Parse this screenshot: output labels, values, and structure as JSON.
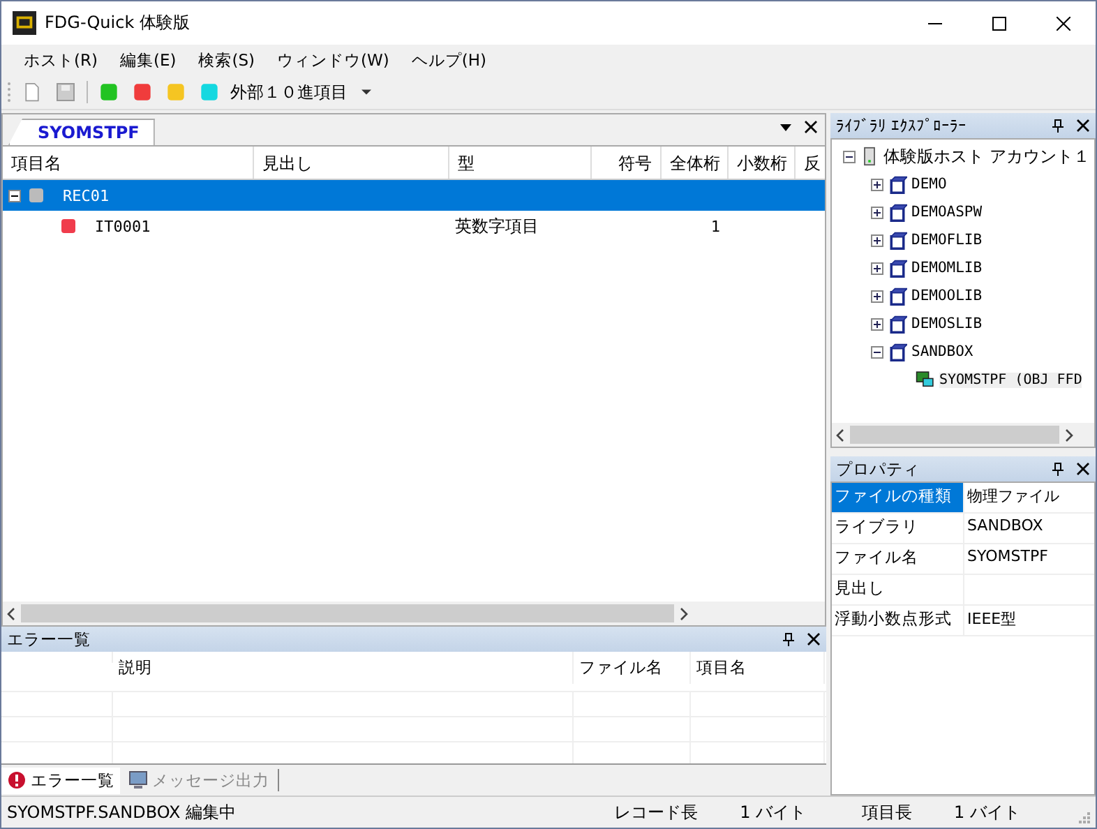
{
  "window": {
    "title": "FDG-Quick 体験版"
  },
  "menu": [
    "ホスト(R)",
    "編集(E)",
    "検索(S)",
    "ウィンドウ(W)",
    "ヘルプ(H)"
  ],
  "toolbar": {
    "colors": [
      {
        "color": "#22c322"
      },
      {
        "color": "#f03c3c"
      },
      {
        "color": "#f5c522"
      },
      {
        "color": "#14d8e0"
      }
    ],
    "dropdown": "外部１０進項目"
  },
  "document_tab": {
    "label": "SYOMSTPF",
    "selected": true
  },
  "grid": {
    "columns": [
      "項目名",
      "見出し",
      "型",
      "符号",
      "全体桁",
      "小数桁",
      "反"
    ],
    "rows": [
      {
        "kind": "record",
        "name": "REC01",
        "heading": "",
        "type": "",
        "total": "",
        "selected": true,
        "expanded": true
      },
      {
        "kind": "field",
        "name": "IT0001",
        "heading": "",
        "type": "英数字項目",
        "total": "1",
        "selected": false,
        "color": "#f03c4c"
      }
    ]
  },
  "error_panel": {
    "title": "エラー一覧",
    "columns": [
      "",
      "説明",
      "ファイル名",
      "項目名"
    ]
  },
  "bottom_tabs": [
    {
      "label": "エラー一覧",
      "selected": true
    },
    {
      "label": "メッセージ出力",
      "selected": false
    }
  ],
  "library_explorer": {
    "title": "ﾗｲﾌﾞﾗﾘ ｴｸｽﾌﾟﾛｰﾗｰ",
    "root": {
      "label": "体験版ホスト アカウント１",
      "expanded": true,
      "children": [
        {
          "label": "DEMO",
          "expanded": false
        },
        {
          "label": "DEMOASPW",
          "expanded": false
        },
        {
          "label": "DEMOFLIB",
          "expanded": false
        },
        {
          "label": "DEMOMLIB",
          "expanded": false
        },
        {
          "label": "DEMOOLIB",
          "expanded": false
        },
        {
          "label": "DEMOSLIB",
          "expanded": false
        },
        {
          "label": "SANDBOX",
          "expanded": true,
          "children": [
            {
              "label": "SYOMSTPF (OBJ  FFD",
              "selected": true
            }
          ]
        }
      ]
    }
  },
  "properties": {
    "title": "プロパティ",
    "rows": [
      {
        "name": "ファイルの種類",
        "value": "物理ファイル",
        "selected": true
      },
      {
        "name": "ライブラリ",
        "value": "SANDBOX",
        "selected": false
      },
      {
        "name": "ファイル名",
        "value": "SYOMSTPF",
        "selected": false
      },
      {
        "name": "見出し",
        "value": "",
        "selected": false
      },
      {
        "name": "浮動小数点形式",
        "value": "IEEE型",
        "selected": false
      }
    ]
  },
  "status_bar": {
    "message": "SYOMSTPF.SANDBOX 編集中",
    "record_length_label": "レコード長",
    "record_length": "1 バイト",
    "field_length_label": "項目長",
    "field_length": "1 バイト"
  }
}
